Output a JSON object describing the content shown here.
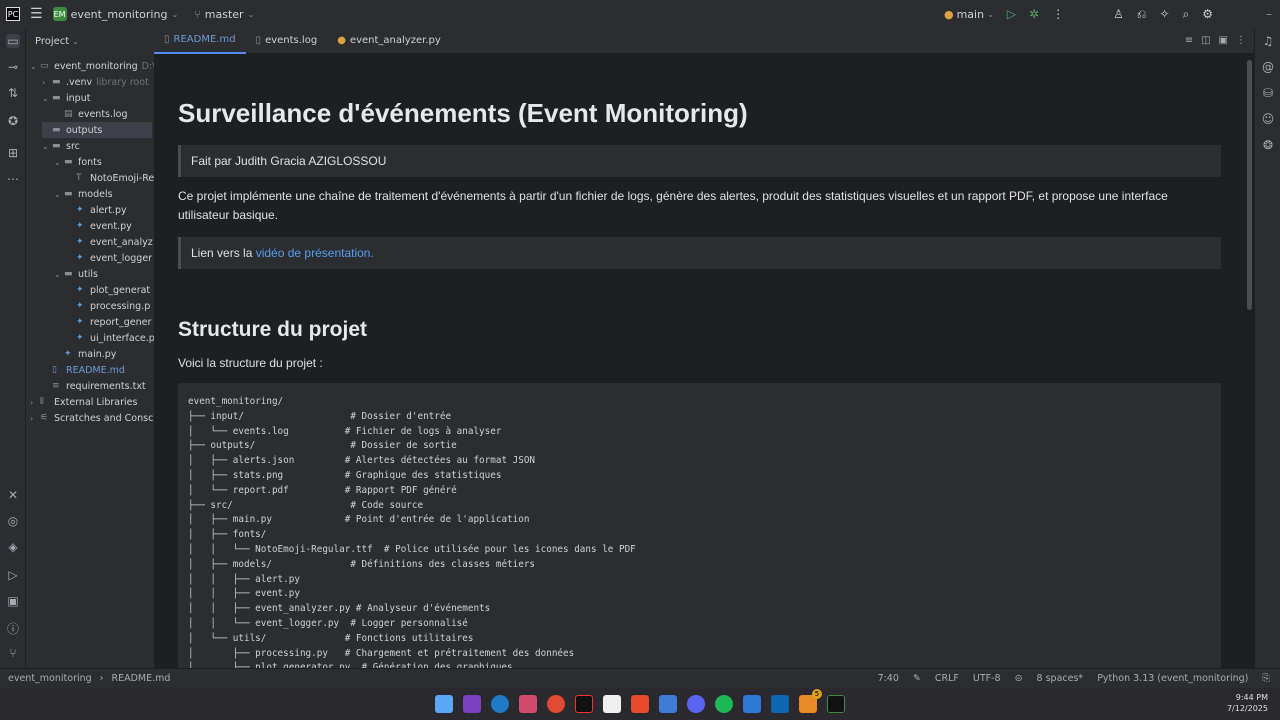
{
  "titlebar": {
    "project_badge": "EM",
    "project_name": "event_monitoring",
    "branch": "master",
    "run_config": "main"
  },
  "project_pane": {
    "header": "Project",
    "tree": [
      {
        "label": "event_monitoring",
        "hint": "D:\\...",
        "indent": 0,
        "kind": "folder-root",
        "arrow": "open"
      },
      {
        "label": ".venv",
        "hint": "library root",
        "indent": 1,
        "kind": "folder",
        "arrow": "closed"
      },
      {
        "label": "input",
        "hint": "",
        "indent": 1,
        "kind": "folder",
        "arrow": "open"
      },
      {
        "label": "events.log",
        "hint": "",
        "indent": 2,
        "kind": "file"
      },
      {
        "label": "outputs",
        "hint": "",
        "indent": 1,
        "kind": "folder",
        "arrow": "",
        "selected": true
      },
      {
        "label": "src",
        "hint": "",
        "indent": 1,
        "kind": "folder",
        "arrow": "open"
      },
      {
        "label": "fonts",
        "hint": "",
        "indent": 2,
        "kind": "folder",
        "arrow": "open"
      },
      {
        "label": "NotoEmoji-Re",
        "hint": "",
        "indent": 3,
        "kind": "font"
      },
      {
        "label": "models",
        "hint": "",
        "indent": 2,
        "kind": "folder",
        "arrow": "open"
      },
      {
        "label": "alert.py",
        "hint": "",
        "indent": 3,
        "kind": "py"
      },
      {
        "label": "event.py",
        "hint": "",
        "indent": 3,
        "kind": "py"
      },
      {
        "label": "event_analyz",
        "hint": "",
        "indent": 3,
        "kind": "py"
      },
      {
        "label": "event_logger",
        "hint": "",
        "indent": 3,
        "kind": "py"
      },
      {
        "label": "utils",
        "hint": "",
        "indent": 2,
        "kind": "folder",
        "arrow": "open"
      },
      {
        "label": "plot_generat",
        "hint": "",
        "indent": 3,
        "kind": "py"
      },
      {
        "label": "processing.p",
        "hint": "",
        "indent": 3,
        "kind": "py"
      },
      {
        "label": "report_gener",
        "hint": "",
        "indent": 3,
        "kind": "py"
      },
      {
        "label": "ui_interface.p",
        "hint": "",
        "indent": 3,
        "kind": "py"
      },
      {
        "label": "main.py",
        "hint": "",
        "indent": 2,
        "kind": "py"
      },
      {
        "label": "README.md",
        "hint": "",
        "indent": 1,
        "kind": "md"
      },
      {
        "label": "requirements.txt",
        "hint": "",
        "indent": 1,
        "kind": "txt"
      },
      {
        "label": "External Libraries",
        "hint": "",
        "indent": 0,
        "kind": "lib",
        "arrow": "closed"
      },
      {
        "label": "Scratches and Consc",
        "hint": "",
        "indent": 0,
        "kind": "scratch",
        "arrow": "closed"
      }
    ]
  },
  "tabs": [
    {
      "label": "README.md",
      "active": true
    },
    {
      "label": "events.log",
      "active": false
    },
    {
      "label": "event_analyzer.py",
      "active": false
    }
  ],
  "doc": {
    "title": "Surveillance d'événements (Event Monitoring)",
    "author_quote": "Fait par Judith Gracia AZIGLOSSOU",
    "intro": "Ce projet implémente une chaîne de traitement d'événements à partir d'un fichier de logs, génère des alertes, produit des statistiques visuelles et un rapport PDF, et propose une interface utilisateur basique.",
    "link_prefix": "Lien vers la ",
    "link_text": "vidéo de présentation.",
    "section_title": "Structure du projet",
    "section_intro": "Voici la structure du projet :",
    "code": "event_monitoring/\n├── input/                   # Dossier d'entrée\n│   └── events.log          # Fichier de logs à analyser\n├── outputs/                 # Dossier de sortie\n│   ├── alerts.json         # Alertes détectées au format JSON\n│   ├── stats.png           # Graphique des statistiques\n│   └── report.pdf          # Rapport PDF généré\n├── src/                     # Code source\n│   ├── main.py             # Point d'entrée de l'application\n│   ├── fonts/\n│   │   └── NotoEmoji-Regular.ttf  # Police utilisée pour les icones dans le PDF\n│   ├── models/              # Définitions des classes métiers\n│   │   ├── alert.py\n│   │   ├── event.py\n│   │   ├── event_analyzer.py # Analyseur d'événements\n│   │   └── event_logger.py  # Logger personnalisé\n│   └── utils/              # Fonctions utilitaires\n│       ├── processing.py   # Chargement et prétraitement des données\n│       ├── plot_generator.py  # Génération des graphiques"
  },
  "statusbar": {
    "crumb_project": "event_monitoring",
    "crumb_file": "README.md",
    "position": "7:40",
    "line_sep": "CRLF",
    "encoding": "UTF-8",
    "indent": "8 spaces*",
    "interpreter": "Python 3.13 (event_monitoring)"
  },
  "taskbar": {
    "time": "9:44 PM",
    "date": "7/12/2025",
    "badge": "5"
  }
}
